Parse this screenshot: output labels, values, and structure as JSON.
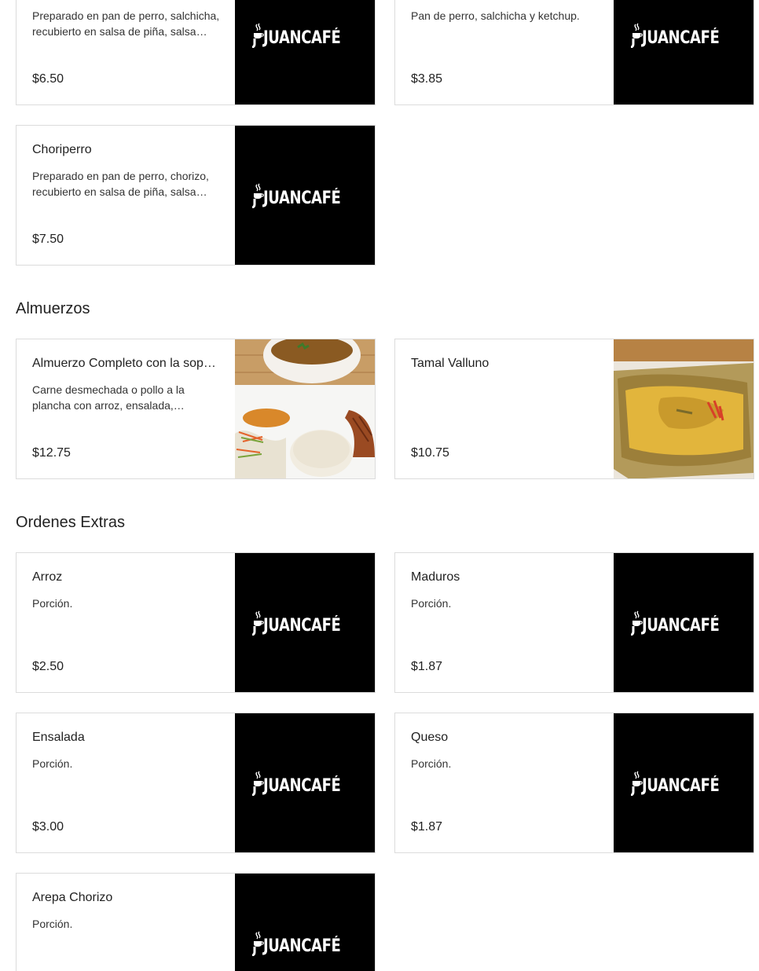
{
  "sections": [
    {
      "title": "",
      "items": [
        {
          "name": "",
          "description": "Preparado en pan de perro, salchicha, recubierto en salsa de piña, salsa rosada y queso rallado.",
          "price": "$6.50",
          "image": "juancafe-logo"
        },
        {
          "name": "",
          "description": "Pan de perro, salchicha y ketchup.",
          "price": "$3.85",
          "image": "juancafe-logo"
        },
        {
          "name": "Choriperro",
          "description": "Preparado en pan de perro, chorizo, recubierto en salsa de piña, salsa rosada y queso rallado.",
          "price": "$7.50",
          "image": "juancafe-logo"
        }
      ]
    },
    {
      "title": "Almuerzos",
      "items": [
        {
          "name": "Almuerzo Completo con la sopa del día",
          "description": "Carne desmechada o pollo a la plancha con arroz, ensalada, empanada y sopa del día.",
          "price": "$12.75",
          "image": "almuerzo-photo"
        },
        {
          "name": "Tamal Valluno",
          "description": "",
          "price": "$10.75",
          "image": "tamal-photo"
        }
      ]
    },
    {
      "title": "Ordenes Extras",
      "items": [
        {
          "name": "Arroz",
          "description": "Porción.",
          "price": "$2.50",
          "image": "juancafe-logo"
        },
        {
          "name": "Maduros",
          "description": "Porción.",
          "price": "$1.87",
          "image": "juancafe-logo"
        },
        {
          "name": "Ensalada",
          "description": "Porción.",
          "price": "$3.00",
          "image": "juancafe-logo"
        },
        {
          "name": "Queso",
          "description": "Porción.",
          "price": "$1.87",
          "image": "juancafe-logo"
        },
        {
          "name": "Arepa Chorizo",
          "description": "Porción.",
          "price": "",
          "image": "juancafe-logo"
        }
      ]
    }
  ],
  "brand": {
    "logo_text": "JUANCAFÉ"
  }
}
